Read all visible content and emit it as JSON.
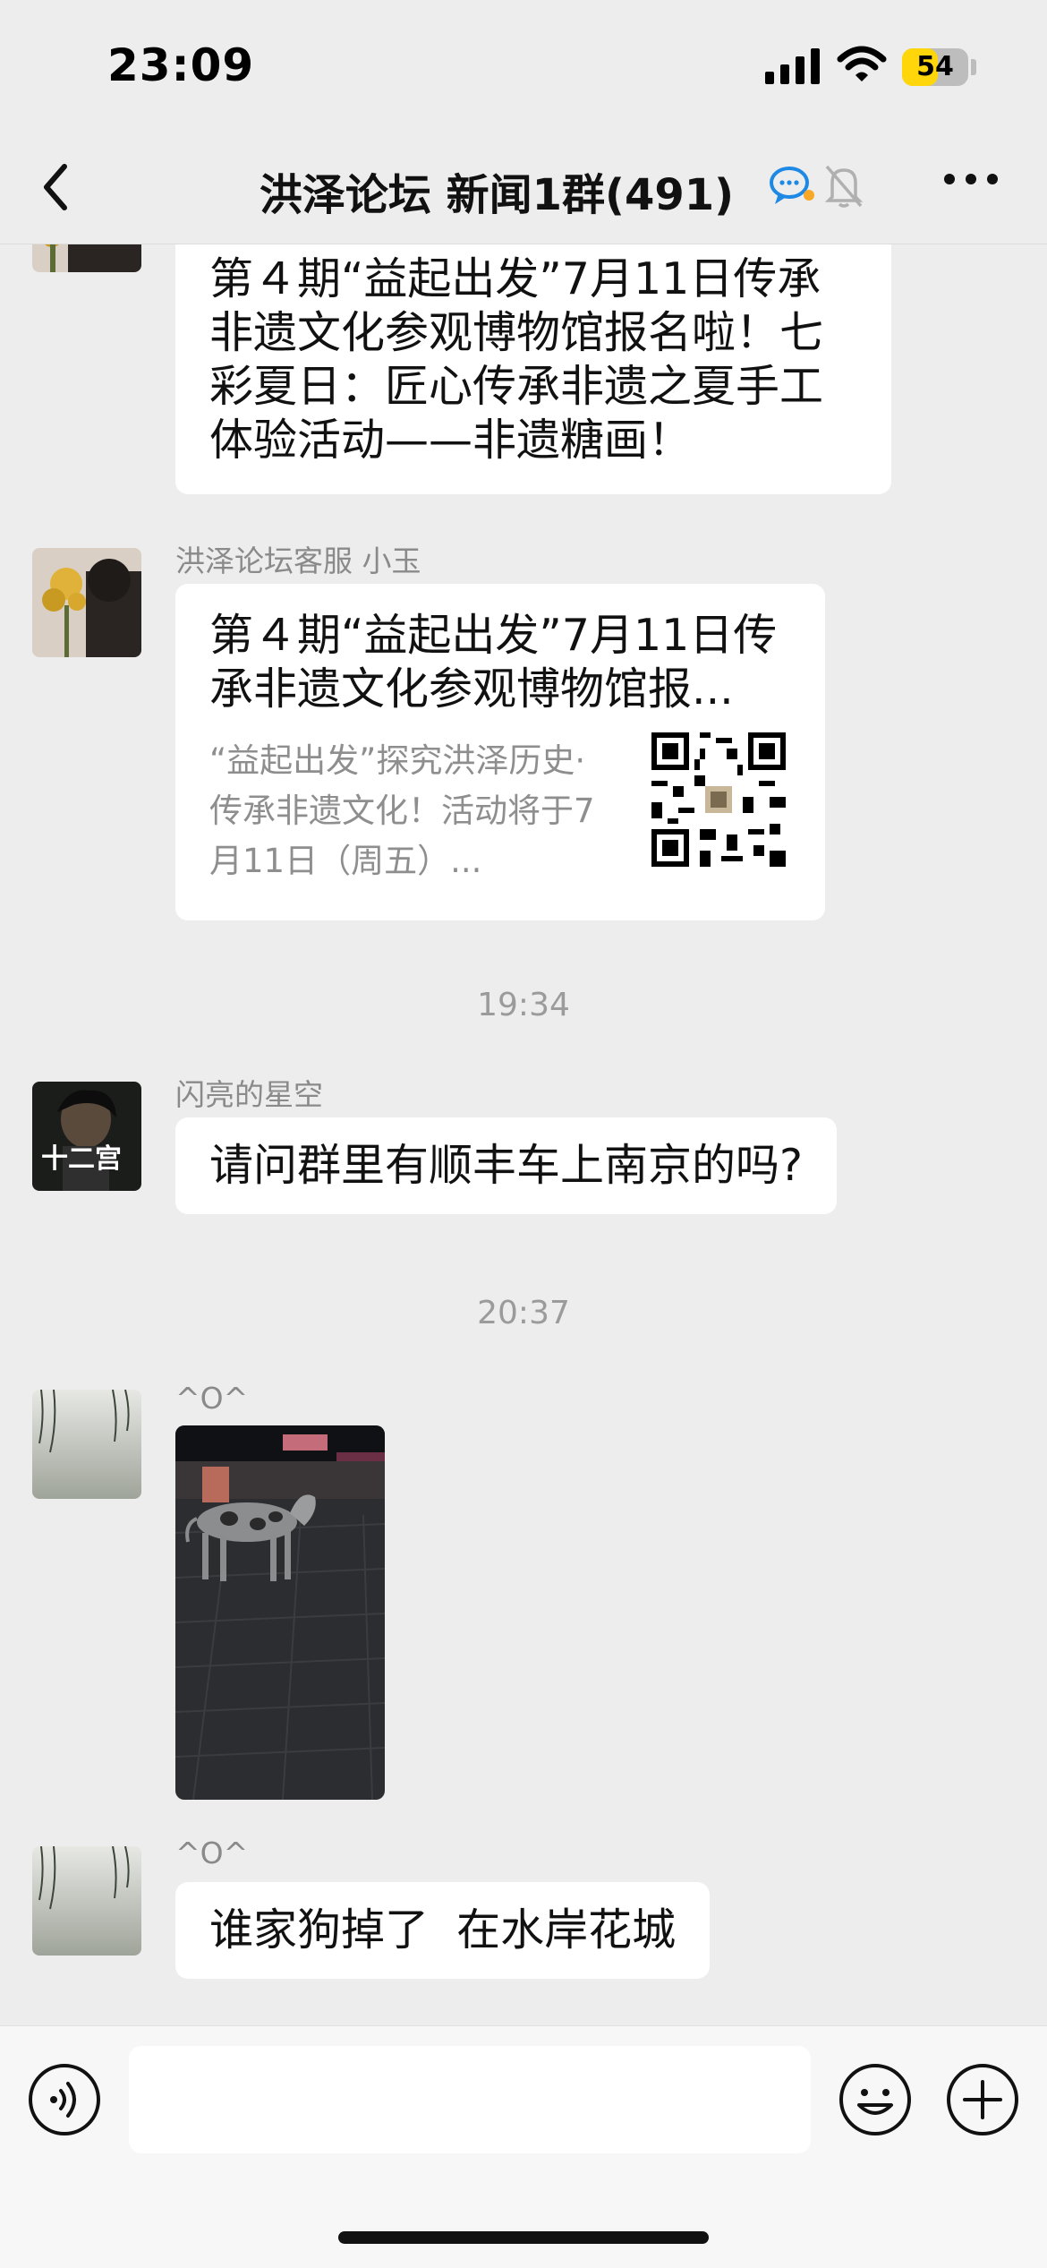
{
  "status_bar": {
    "time": "23:09",
    "battery": "54",
    "battery_level_percent": 54,
    "icons": [
      "signal-icon",
      "wifi-icon",
      "battery-icon"
    ]
  },
  "nav": {
    "title": "洪泽论坛 新闻1群(491)",
    "icons": [
      "back-icon",
      "chat-bubble-icon",
      "mute-bell-icon",
      "more-icon"
    ]
  },
  "messages": {
    "m1": {
      "text": "第４期“益起出发”7月11日传承非遗文化参观博物馆报名啦！七彩夏日：匠心传承非遗之夏手工体验活动——非遗糖画！"
    },
    "m2": {
      "sender": "洪泽论坛客服 小玉",
      "card_title": "第４期“益起出发”7月11日传承非遗文化参观博物馆报...",
      "card_desc": "“益起出发”探究洪泽历史·传承非遗文化！活动将于7月11日（周五）..."
    },
    "ts1": "19:34",
    "m3": {
      "sender": "闪亮的星空",
      "text": "请问群里有顺丰车上南京的吗?",
      "avatar_text": "十二宫"
    },
    "ts2": "20:37",
    "m4": {
      "sender": "^O^"
    },
    "m5": {
      "sender": "^O^",
      "text": "谁家狗掉了  在水岸花城"
    }
  },
  "input_bar": {
    "icons": [
      "voice-icon",
      "emoji-icon",
      "add-icon"
    ]
  },
  "colors": {
    "background": "#ededed",
    "bubble": "#ffffff",
    "battery_fill": "#ffd60a",
    "timestamp": "#9b9b9b"
  }
}
